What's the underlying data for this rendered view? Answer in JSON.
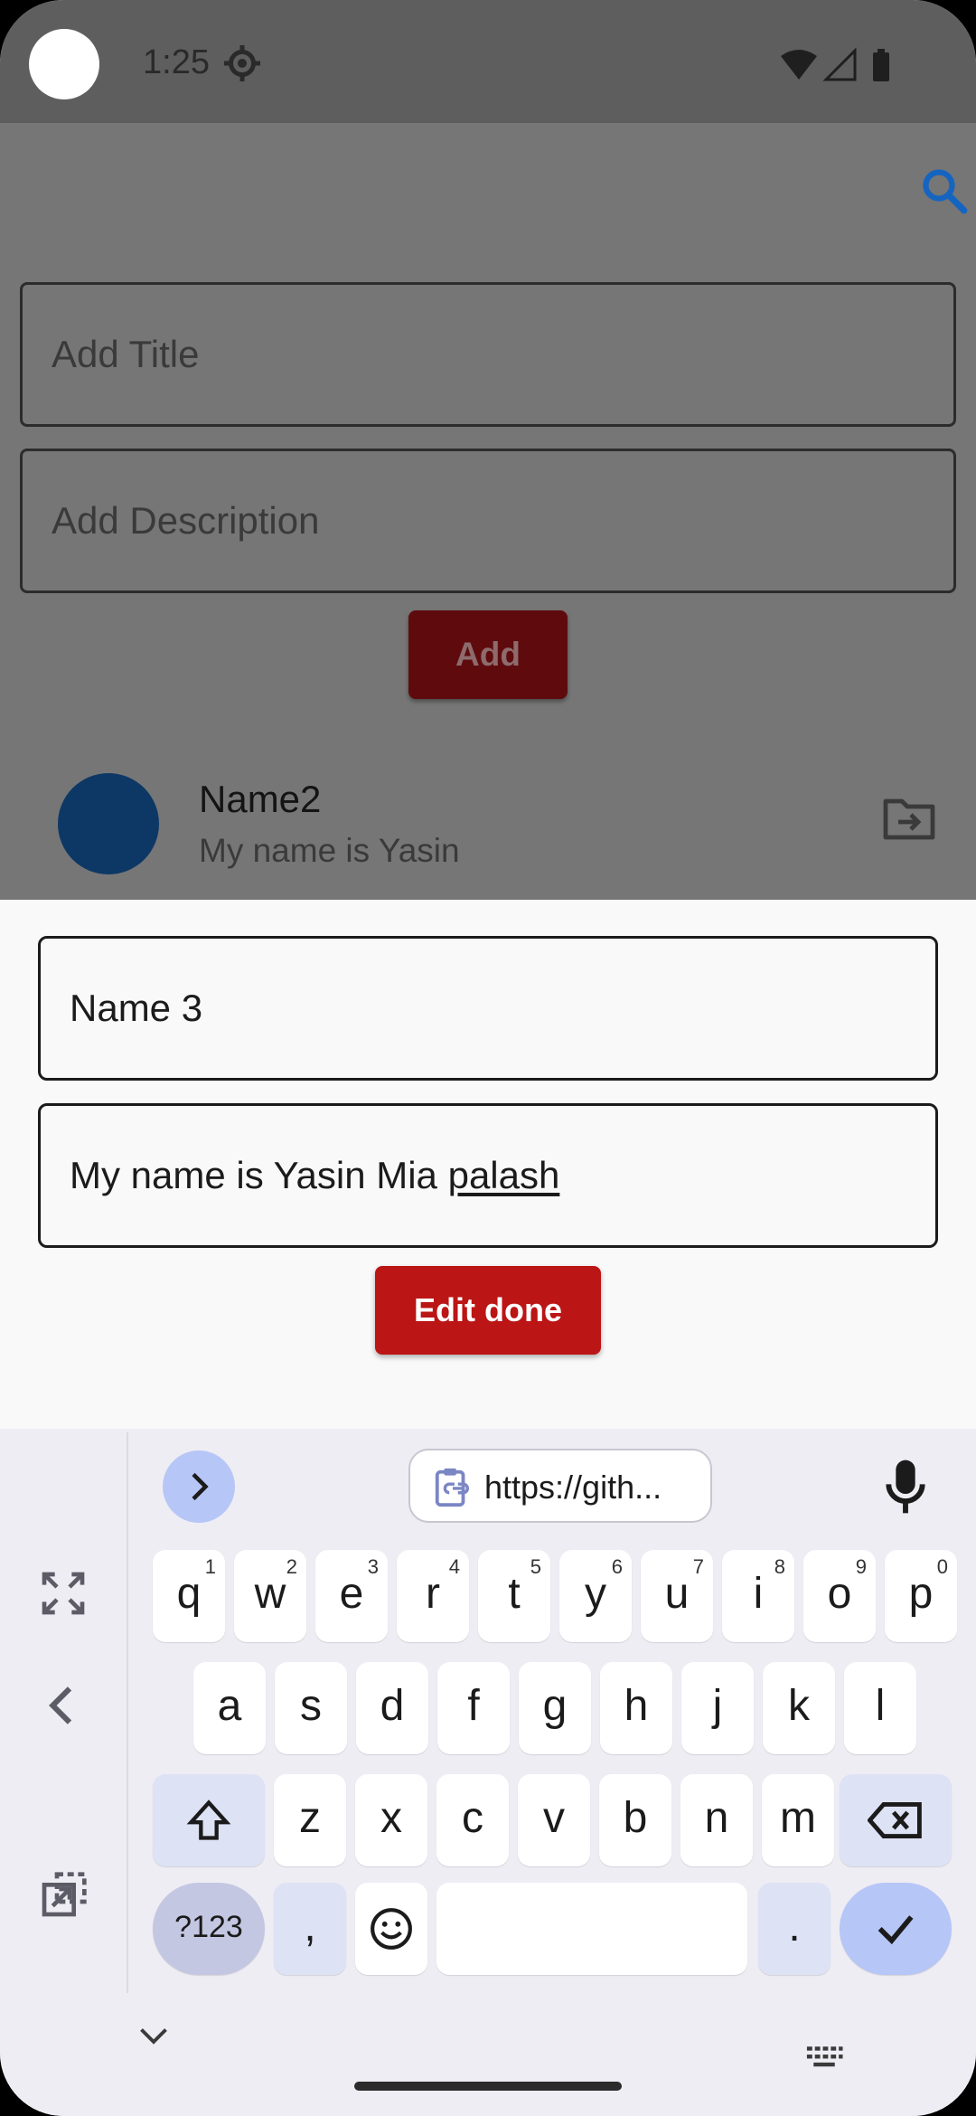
{
  "status_bar": {
    "time": "1:25",
    "icons": [
      "settings-icon",
      "wifi-icon",
      "signal-icon",
      "battery-icon"
    ]
  },
  "app_bar": {
    "icons": [
      "search-icon"
    ],
    "accent": "#1565c0"
  },
  "form": {
    "title_placeholder": "Add Title",
    "description_placeholder": "Add Description",
    "add_label": "Add"
  },
  "list": {
    "items": [
      {
        "title": "Name2",
        "subtitle": "My name is Yasin",
        "avatar_color": "#0d3866",
        "icon": "folder-move-icon"
      }
    ]
  },
  "sheet": {
    "title_value": "Name 3",
    "description_prefix": "My name is Yasin Mia ",
    "description_underlined": "palash",
    "submit_label": "Edit done",
    "submit_color": "#bb1515"
  },
  "keyboard": {
    "clipboard_suggestion": "https://gith...",
    "rows": [
      [
        {
          "c": "q",
          "h": "1"
        },
        {
          "c": "w",
          "h": "2"
        },
        {
          "c": "e",
          "h": "3"
        },
        {
          "c": "r",
          "h": "4"
        },
        {
          "c": "t",
          "h": "5"
        },
        {
          "c": "y",
          "h": "6"
        },
        {
          "c": "u",
          "h": "7"
        },
        {
          "c": "i",
          "h": "8"
        },
        {
          "c": "o",
          "h": "9"
        },
        {
          "c": "p",
          "h": "0"
        }
      ],
      [
        {
          "c": "a"
        },
        {
          "c": "s"
        },
        {
          "c": "d"
        },
        {
          "c": "f"
        },
        {
          "c": "g"
        },
        {
          "c": "h"
        },
        {
          "c": "j"
        },
        {
          "c": "k"
        },
        {
          "c": "l"
        }
      ],
      [
        {
          "c": "z"
        },
        {
          "c": "x"
        },
        {
          "c": "c"
        },
        {
          "c": "v"
        },
        {
          "c": "b"
        },
        {
          "c": "n"
        },
        {
          "c": "m"
        }
      ]
    ],
    "symbols_label": "?123",
    "comma_label": ",",
    "period_label": ".",
    "icons": [
      "expand-icon",
      "fullscreen-icon",
      "back-arrow-icon",
      "floating-keyboard-icon",
      "clipboard-icon",
      "microphone-icon",
      "shift-icon",
      "backspace-icon",
      "emoji-icon",
      "checkmark-icon"
    ]
  },
  "nav_bar": {
    "icons": [
      "hide-keyboard-icon",
      "keyboard-switch-icon"
    ]
  }
}
